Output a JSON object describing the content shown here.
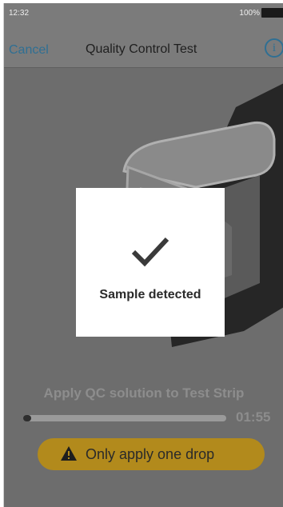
{
  "status_bar": {
    "time": "12:32",
    "battery_percent": "100%"
  },
  "nav": {
    "cancel_label": "Cancel",
    "title": "Quality Control Test",
    "info_icon": "i"
  },
  "overlay": {
    "message": "Sample detected",
    "icon": "checkmark-icon"
  },
  "instruction": "Apply QC solution to Test Strip",
  "progress": {
    "fraction": 0.04,
    "timer": "01:55"
  },
  "warning": {
    "label": "Only apply one drop",
    "icon": "warning-triangle-icon"
  },
  "colors": {
    "accent": "#2f6f93",
    "warning_bg": "#b28a1c",
    "background": "#6d6d6d"
  }
}
